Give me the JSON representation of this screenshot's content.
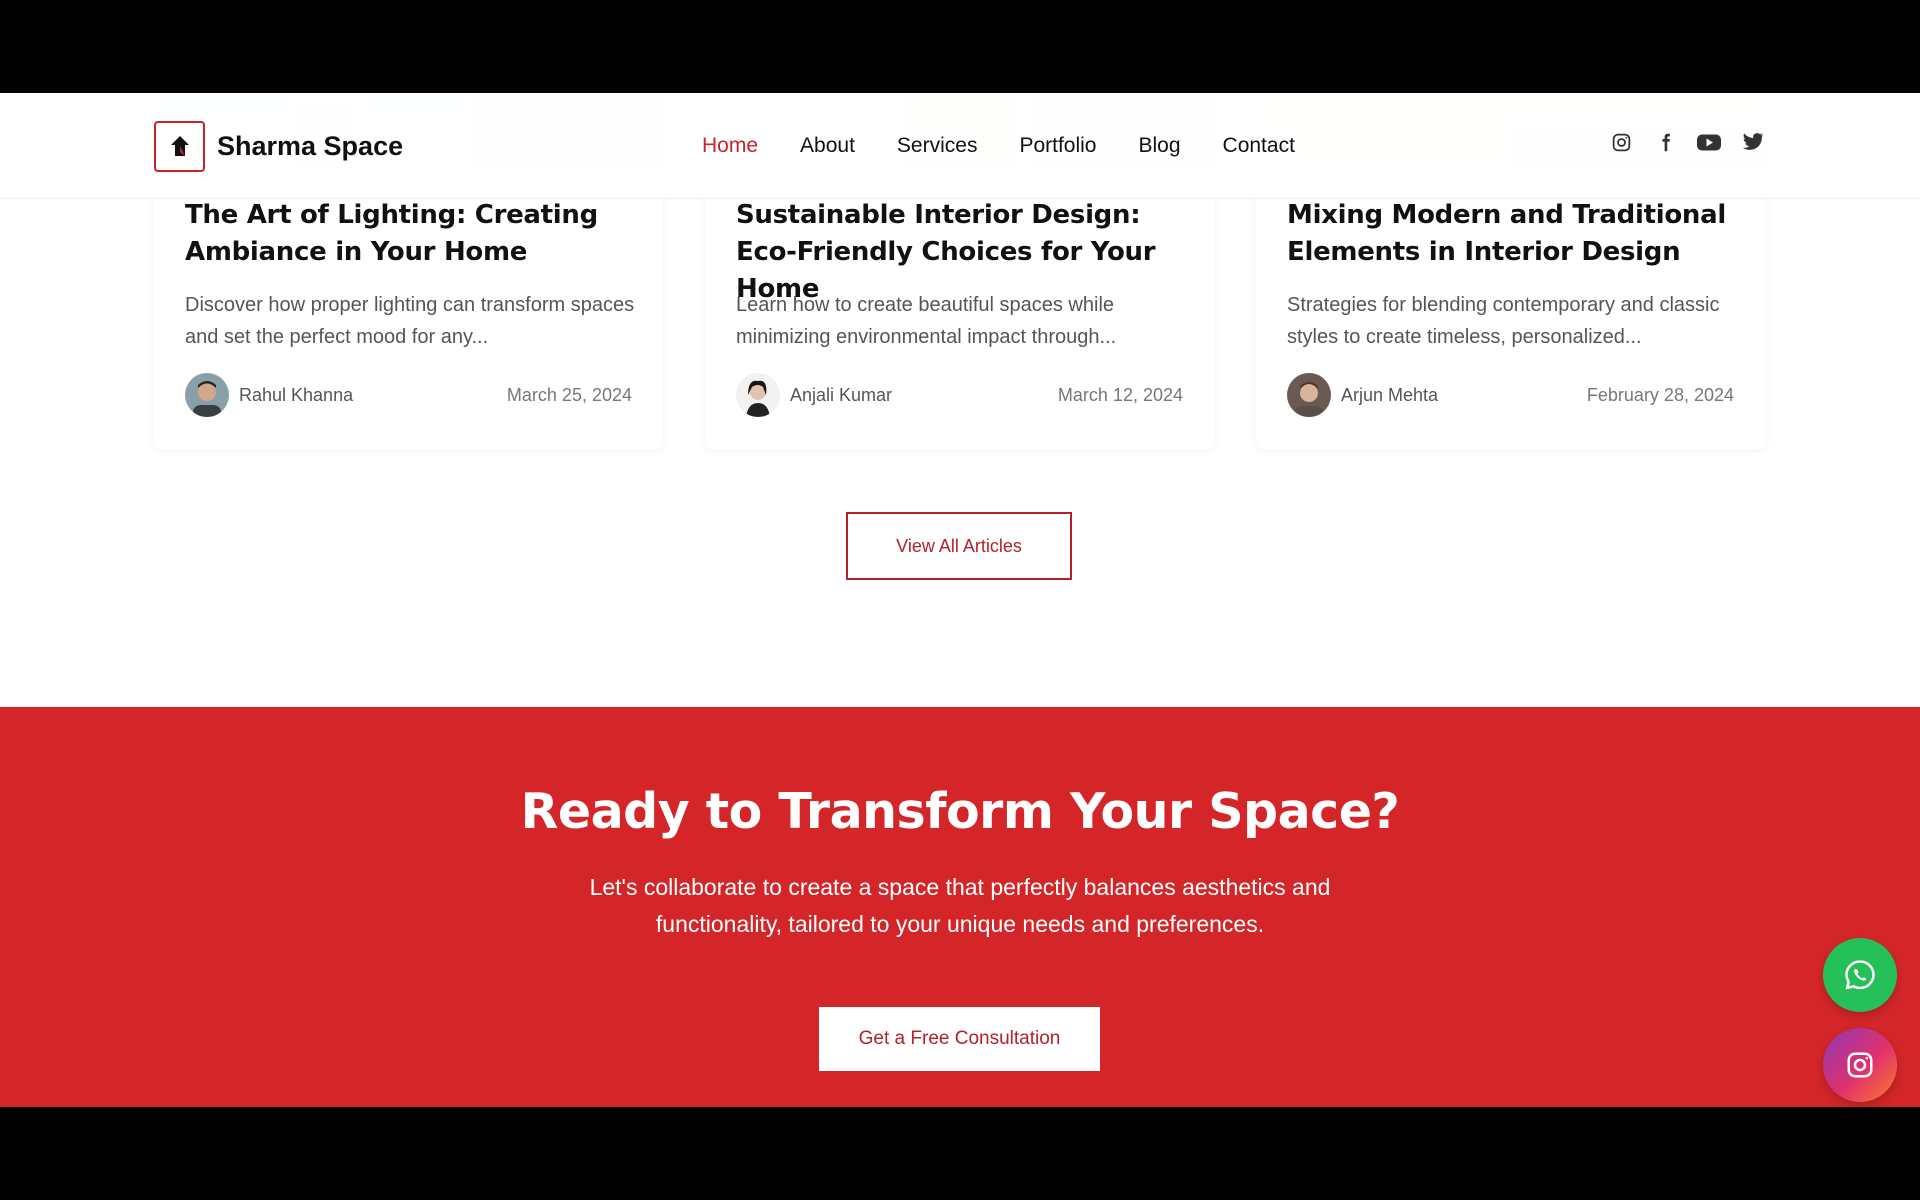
{
  "header": {
    "brand": "Sharma Space",
    "nav": [
      {
        "label": "Home",
        "active": true
      },
      {
        "label": "About",
        "active": false
      },
      {
        "label": "Services",
        "active": false
      },
      {
        "label": "Portfolio",
        "active": false
      },
      {
        "label": "Blog",
        "active": false
      },
      {
        "label": "Contact",
        "active": false
      }
    ],
    "social_icons": [
      "instagram-icon",
      "facebook-icon",
      "youtube-icon",
      "twitter-icon"
    ]
  },
  "blog": {
    "cards": [
      {
        "title": "The Art of Lighting: Creating Ambiance in Your Home",
        "excerpt": "Discover how proper lighting can transform spaces and set the perfect mood for any...",
        "author": "Rahul Khanna",
        "date": "March 25, 2024"
      },
      {
        "title": "Sustainable Interior Design: Eco-Friendly Choices for Your Home",
        "excerpt": "Learn how to create beautiful spaces while minimizing environmental impact through...",
        "author": "Anjali Kumar",
        "date": "March 12, 2024"
      },
      {
        "title": "Mixing Modern and Traditional Elements in Interior Design",
        "excerpt": "Strategies for blending contemporary and classic styles to create timeless, personalized...",
        "author": "Arjun Mehta",
        "date": "February 28, 2024"
      }
    ],
    "view_all_label": "View All Articles"
  },
  "cta": {
    "title": "Ready to Transform Your Space?",
    "text": "Let's collaborate to create a space that perfectly balances aesthetics and functionality, tailored to your unique needs and preferences.",
    "button_label": "Get a Free Consultation"
  },
  "floating": [
    "whatsapp-icon",
    "instagram-icon"
  ],
  "colors": {
    "accent": "#c8232b",
    "cta_background": "#d42629",
    "whatsapp": "#25c05a"
  }
}
